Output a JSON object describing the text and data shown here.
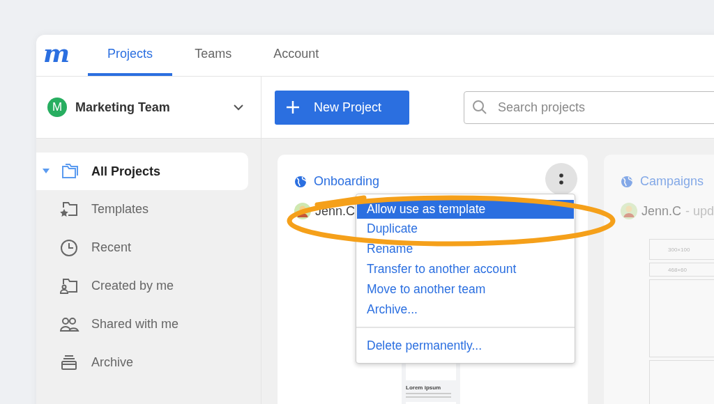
{
  "logo": "m",
  "tabs": [
    {
      "label": "Projects",
      "selected": true
    },
    {
      "label": "Teams",
      "selected": false
    },
    {
      "label": "Account",
      "selected": false
    }
  ],
  "team": {
    "initial": "M",
    "name": "Marketing Team",
    "color": "#27ae60"
  },
  "sidebar": {
    "items": [
      {
        "label": "All Projects",
        "kind": "folders",
        "selected": true,
        "expanded": true
      },
      {
        "label": "Templates",
        "kind": "folder-star",
        "selected": false
      },
      {
        "label": "Recent",
        "kind": "clock",
        "selected": false
      },
      {
        "label": "Created by me",
        "kind": "folder-person",
        "selected": false
      },
      {
        "label": "Shared with me",
        "kind": "people",
        "selected": false
      },
      {
        "label": "Archive",
        "kind": "archive",
        "selected": false
      }
    ]
  },
  "toolbar": {
    "new_button": "New Project",
    "search": {
      "placeholder": "Search projects"
    }
  },
  "projects": [
    {
      "title": "Onboarding",
      "owner": "Jenn.C",
      "dimmed": false,
      "thumbnail": {
        "kind": "mobile",
        "caption": "Lorem ipsum"
      }
    },
    {
      "title": "Campaigns",
      "owner": "Jenn.C",
      "updated": "- upd",
      "dimmed": true,
      "thumbnail": {
        "kind": "banners",
        "labels": [
          "300×100",
          "468×60"
        ]
      }
    }
  ],
  "menu": {
    "items": [
      {
        "label": "Allow use as template",
        "selected": true,
        "kind": "action"
      },
      {
        "label": "Duplicate",
        "selected": false,
        "kind": "action"
      },
      {
        "label": "Rename",
        "selected": false,
        "kind": "action"
      },
      {
        "label": "Transfer to another account",
        "selected": false,
        "kind": "action"
      },
      {
        "label": "Move to another team",
        "selected": false,
        "kind": "action"
      },
      {
        "label": "Archive...",
        "selected": false,
        "kind": "action"
      },
      {
        "label": "Delete permanently...",
        "selected": false,
        "kind": "separated"
      }
    ]
  }
}
